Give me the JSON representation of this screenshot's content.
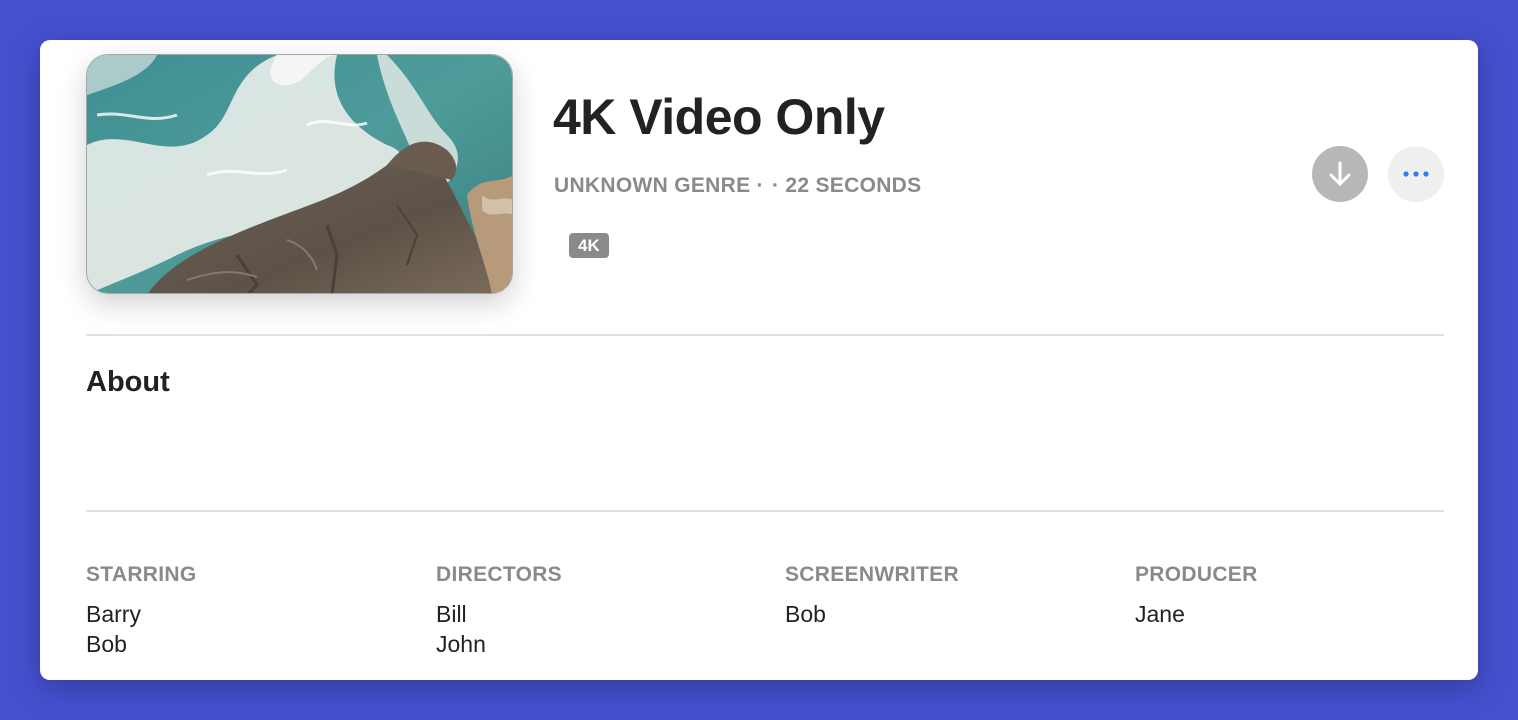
{
  "video": {
    "title": "4K Video Only",
    "genre": "UNKNOWN GENRE ·",
    "duration": "· 22 SECONDS",
    "badge": "4K"
  },
  "actions": {
    "download_icon": "arrow-down-icon",
    "more_icon": "ellipsis-icon",
    "accent_color": "#2e7cf6"
  },
  "about": {
    "heading": "About"
  },
  "credits": {
    "starring": {
      "label": "STARRING",
      "names": [
        "Barry",
        "Bob"
      ]
    },
    "directors": {
      "label": "DIRECTORS",
      "names": [
        "Bill",
        "John"
      ]
    },
    "screenwriter": {
      "label": "SCREENWRITER",
      "names": [
        "Bob"
      ]
    },
    "producer": {
      "label": "PRODUCER",
      "names": [
        "Jane"
      ]
    }
  }
}
